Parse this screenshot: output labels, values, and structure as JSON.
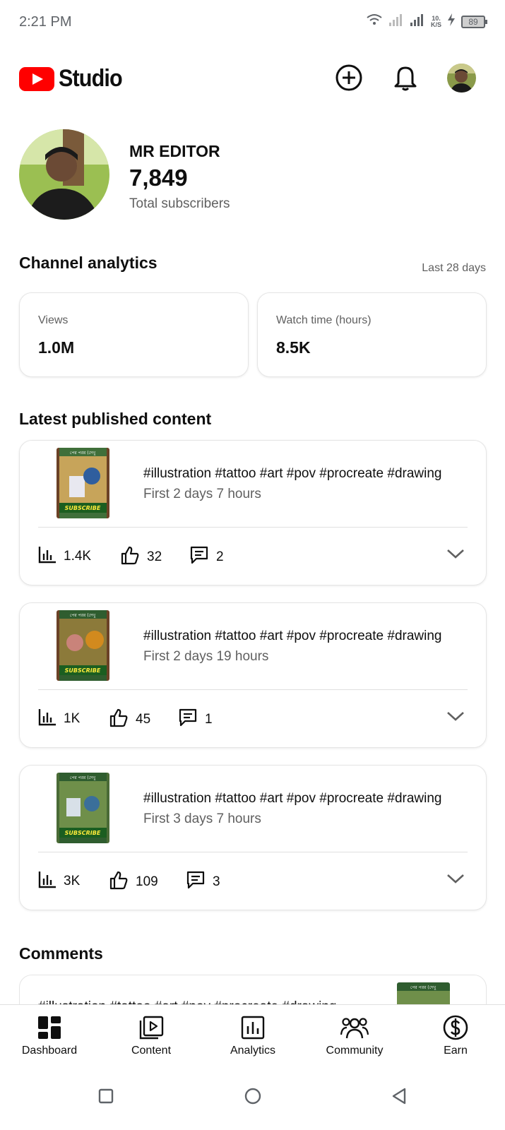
{
  "status_bar": {
    "time": "2:21 PM",
    "net_speed_value": "10.",
    "net_speed_unit": "K/S",
    "battery": "89"
  },
  "header": {
    "logo_text": "Studio"
  },
  "channel": {
    "name": "MR EDITOR",
    "subscribers": "7,849",
    "subscribers_label": "Total subscribers"
  },
  "analytics": {
    "title": "Channel analytics",
    "period": "Last 28 days",
    "metrics": [
      {
        "label": "Views",
        "value": "1.0M"
      },
      {
        "label": "Watch time (hours)",
        "value": "8.5K"
      }
    ]
  },
  "latest": {
    "title": "Latest published content",
    "videos": [
      {
        "title": "#illustration #tattoo #art #pov #procreate #drawing",
        "subtitle": "First 2 days 7 hours",
        "views": "1.4K",
        "likes": "32",
        "comments": "2"
      },
      {
        "title": "#illustration #tattoo #art #pov #procreate #drawing",
        "subtitle": "First 2 days 19 hours",
        "views": "1K",
        "likes": "45",
        "comments": "1"
      },
      {
        "title": "#illustration #tattoo #art #pov #procreate #drawing",
        "subtitle": "First 3 days 7 hours",
        "views": "3K",
        "likes": "109",
        "comments": "3"
      }
    ]
  },
  "comments": {
    "title": "Comments",
    "first_item_text": "#illustration #tattoo #art #pov #procreate #drawing"
  },
  "thumbnail": {
    "banner_text": "পের পরর (দেখু",
    "subscribe_label": "SUBSCRIBE"
  },
  "bottom_nav": [
    {
      "label": "Dashboard",
      "icon": "dashboard-icon"
    },
    {
      "label": "Content",
      "icon": "content-icon"
    },
    {
      "label": "Analytics",
      "icon": "analytics-icon"
    },
    {
      "label": "Community",
      "icon": "community-icon"
    },
    {
      "label": "Earn",
      "icon": "earn-icon"
    }
  ],
  "colors": {
    "brand_red": "#ff0000",
    "text_primary": "#0f0f0f",
    "text_secondary": "#606060"
  }
}
